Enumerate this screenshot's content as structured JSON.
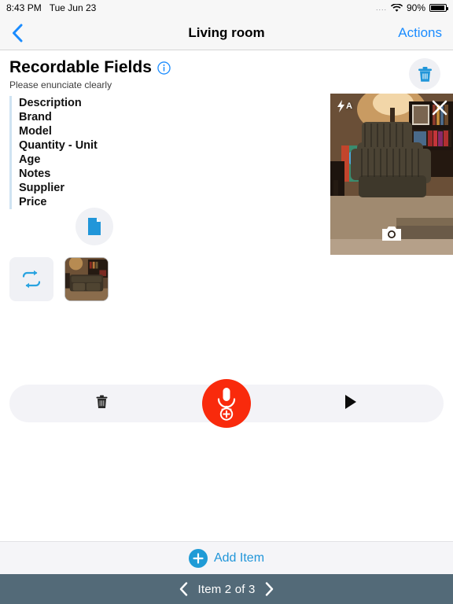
{
  "status_bar": {
    "time": "8:43 PM",
    "date": "Tue Jun 23",
    "signal_dots": "....",
    "wifi_icon": "wifi-icon",
    "battery_percent": "90%"
  },
  "nav_bar": {
    "back_icon": "chevron-left-icon",
    "title": "Living room",
    "actions_label": "Actions"
  },
  "section": {
    "title": "Recordable Fields",
    "info_icon": "info-circle-icon",
    "subtitle": "Please enunciate clearly",
    "fields": [
      "Description",
      "Brand",
      "Model",
      "Quantity - Unit",
      "Age",
      "Notes",
      "Supplier",
      "Price"
    ]
  },
  "buttons": {
    "document_icon": "document-icon",
    "swap_icon": "swap-arrows-icon",
    "trash_icon": "trash-icon",
    "photo_thumbnail": "photo-thumbnail"
  },
  "camera": {
    "flash_mode": "A",
    "flash_icon": "flash-auto-icon",
    "close_icon": "close-x-icon",
    "shutter_icon": "camera-shutter-icon"
  },
  "recorder": {
    "delete_icon": "trash-icon",
    "record_icon": "microphone-add-icon",
    "play_icon": "play-triangle-icon"
  },
  "add_bar": {
    "plus_icon": "plus-circle-icon",
    "label": "Add Item"
  },
  "pager": {
    "prev_icon": "chevron-left-icon",
    "label": "Item 2 of 3",
    "next_icon": "chevron-right-icon"
  },
  "colors": {
    "accent_blue": "#2196d9",
    "nav_blue": "#1a8cff",
    "record_red": "#f92a0c",
    "pager_bg": "#536a78",
    "field_rule": "#cfe3f2"
  }
}
